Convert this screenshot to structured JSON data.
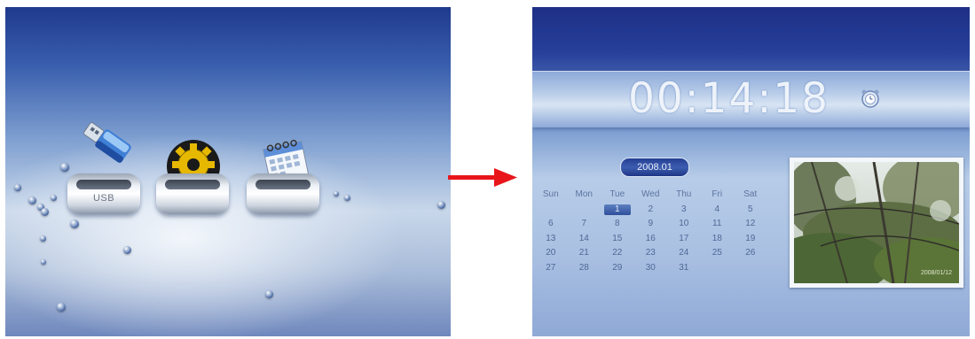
{
  "left_screen": {
    "menu_items": [
      {
        "id": "usb",
        "label": "USB",
        "icon": "usb-drive-icon"
      },
      {
        "id": "settings",
        "label": "",
        "icon": "gear-icon"
      },
      {
        "id": "calendar",
        "label": "",
        "icon": "calendar-icon"
      }
    ]
  },
  "transition": {
    "icon": "right-arrow-icon",
    "color": "#e8161b"
  },
  "right_screen": {
    "clock": {
      "time": "00:14:18",
      "alarm_icon": "alarm-clock-icon"
    },
    "calendar": {
      "month": "2008.01",
      "weekdays": [
        "Sun",
        "Mon",
        "Tue",
        "Wed",
        "Thu",
        "Fri",
        "Sat"
      ],
      "weeks": [
        [
          "",
          "",
          "1",
          "2",
          "3",
          "4",
          "5"
        ],
        [
          "6",
          "7",
          "8",
          "9",
          "10",
          "11",
          "12"
        ],
        [
          "13",
          "14",
          "15",
          "16",
          "17",
          "18",
          "19"
        ],
        [
          "20",
          "21",
          "22",
          "23",
          "24",
          "25",
          "26"
        ],
        [
          "27",
          "28",
          "29",
          "30",
          "31",
          "",
          ""
        ]
      ],
      "selected_day": "1"
    },
    "photo": {
      "caption_date": "2008/01/12"
    }
  },
  "colors": {
    "arrow": "#e8161b",
    "screen_blue": "#27409a",
    "gear": "#e6b800"
  }
}
